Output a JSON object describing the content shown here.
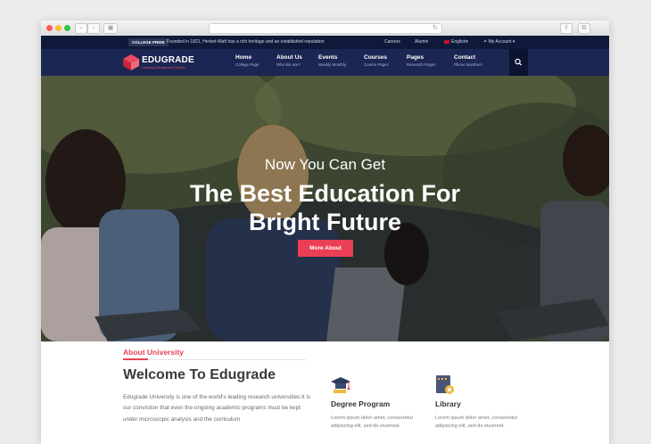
{
  "topbar": {
    "badge": "COLLEGE PRIDE",
    "note": "Founded in 1821, Herbet-Watt has a rich heritage and an established reputation",
    "links": [
      "Careers",
      "Alumni",
      "English",
      "My Account"
    ]
  },
  "nav": {
    "logo": "EDUGRADE",
    "tagline": "Learning Management System",
    "items": [
      {
        "title": "Home",
        "sub": "College Page"
      },
      {
        "title": "About Us",
        "sub": "Who We are?"
      },
      {
        "title": "Events",
        "sub": "Weekly Monthly"
      },
      {
        "title": "Courses",
        "sub": "Course Pages"
      },
      {
        "title": "Pages",
        "sub": "Research Pages"
      },
      {
        "title": "Contact",
        "sub": "Phone Numbers"
      }
    ]
  },
  "hero": {
    "subtitle": "Now You Can Get",
    "title_line1": "The Best Education For",
    "title_line2": "Bright Future",
    "button": "More About"
  },
  "about": {
    "label": "About University",
    "title": "Welcome To Edugrade",
    "paragraph": "Edugrade University is one of the world's leading research universities.It is our conviction that even the ongoing academic programs must be kept under microscopic analysis and the curriculum"
  },
  "features": [
    {
      "icon": "graduation-cap-icon",
      "title": "Degree Program",
      "text": "Lorem ipsum dolor amet, consectetur adipiscing elit, sed do eiusmod."
    },
    {
      "icon": "library-book-icon",
      "title": "Library",
      "text": "Lorem ipsum dolor amet, consectetur adipiscing elit, sed do eiusmod."
    }
  ],
  "colors": {
    "accent": "#ea3f54",
    "navy": "#1b2652",
    "topbar": "#0f1a3a"
  }
}
